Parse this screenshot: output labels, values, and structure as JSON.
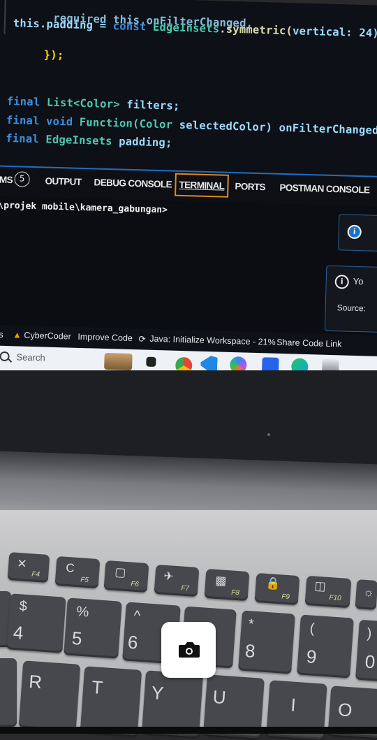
{
  "code": {
    "line1": "required this.onFilterChanged,",
    "line2_a": "this.padding = ",
    "line2_b": "const ",
    "line2_c": "EdgeInsets",
    "line2_d": ".symmetric(",
    "line2_e": "vertical: 24)",
    "line3": "});",
    "line4_a": "final ",
    "line4_b": "List<Color> ",
    "line4_c": "filters;",
    "line5_a": "final ",
    "line5_b": "void ",
    "line5_c": "Function(",
    "line5_d": "Color ",
    "line5_e": "selectedColor) ",
    "line5_f": "onFilterChanged;",
    "line6_a": "final ",
    "line6_b": "EdgeInsets ",
    "line6_c": "padding;"
  },
  "panel": {
    "tabs": {
      "problems": "EMS",
      "problems_count": "5",
      "output": "OUTPUT",
      "debug": "DEBUG CONSOLE",
      "terminal": "TERMINAL",
      "ports": "PORTS",
      "postman": "POSTMAN CONSOLE"
    },
    "prompt": ":\\projek mobile\\kamera_gabungan>",
    "notification_2_text": "Yo",
    "notification_2_source": "Source:"
  },
  "statusbar": {
    "logs": "ogs",
    "cybercoder": "CyberCoder",
    "improve": "Improve Code",
    "java": "Java: Initialize Workspace - 21%",
    "share": "Share Code Link"
  },
  "taskbar": {
    "search_placeholder": "Search"
  },
  "keyboard": {
    "f4": "F4",
    "f5": "F5",
    "f6": "F6",
    "f7": "F7",
    "f8": "F8",
    "f9": "F9",
    "f10": "F10",
    "k4_top": "$",
    "k4": "4",
    "k5_top": "%",
    "k5": "5",
    "k6_top": "^",
    "k6": "6",
    "k8_top": "*",
    "k8": "8",
    "k9_top": "(",
    "k9": "9",
    "k0_top": ")",
    "k0": "0",
    "r": "R",
    "t": "T",
    "y": "Y",
    "u": "U",
    "i": "I",
    "o": "O"
  },
  "colors": {
    "editor_bg": "#0e1017",
    "active_tab_border": "#e08a1e",
    "key": "#47484d",
    "deck": "#bdbec0"
  }
}
